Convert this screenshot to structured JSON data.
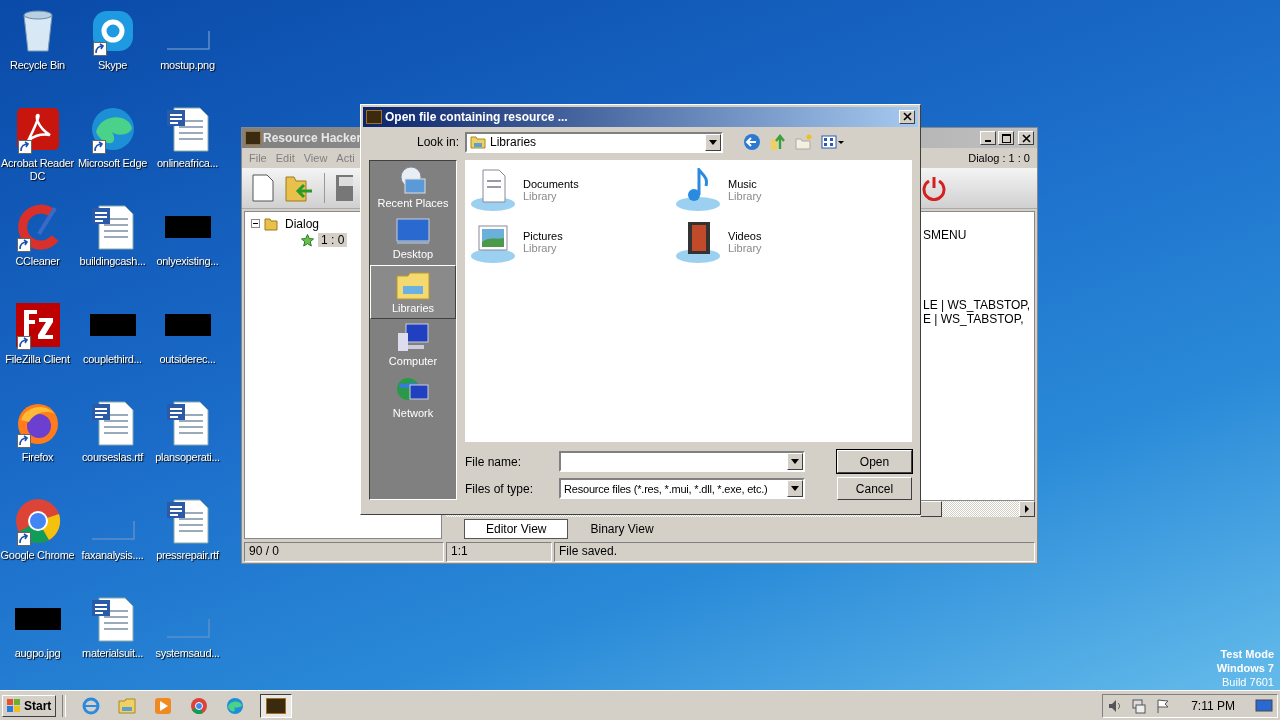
{
  "desktop": {
    "icons": [
      {
        "label": "Recycle Bin",
        "kind": "recycle",
        "shortcut": false
      },
      {
        "label": "Skype",
        "kind": "skype",
        "shortcut": true
      },
      {
        "label": "mostup.png",
        "kind": "blank",
        "shortcut": false
      },
      {
        "label": "Acrobat Reader DC",
        "kind": "acrobat",
        "shortcut": true
      },
      {
        "label": "Microsoft Edge",
        "kind": "edge",
        "shortcut": true
      },
      {
        "label": "onlineafrica...",
        "kind": "doc",
        "shortcut": false
      },
      {
        "label": "CCleaner",
        "kind": "ccleaner",
        "shortcut": true
      },
      {
        "label": "buildingcash...",
        "kind": "doc",
        "shortcut": false
      },
      {
        "label": "onlyexisting...",
        "kind": "black",
        "shortcut": false
      },
      {
        "label": "FileZilla Client",
        "kind": "filezilla",
        "shortcut": true
      },
      {
        "label": "couplethird...",
        "kind": "black",
        "shortcut": false
      },
      {
        "label": "outsiderec...",
        "kind": "black",
        "shortcut": false
      },
      {
        "label": "Firefox",
        "kind": "firefox",
        "shortcut": true
      },
      {
        "label": "courseslas.rtf",
        "kind": "doc",
        "shortcut": false
      },
      {
        "label": "plansoperati...",
        "kind": "doc",
        "shortcut": false
      },
      {
        "label": "Google Chrome",
        "kind": "chrome",
        "shortcut": true
      },
      {
        "label": "faxanalysis....",
        "kind": "blank",
        "shortcut": false
      },
      {
        "label": "pressrepair.rtf",
        "kind": "doc",
        "shortcut": false
      },
      {
        "label": "augpo.jpg",
        "kind": "black",
        "shortcut": false
      },
      {
        "label": "materialsuit...",
        "kind": "doc",
        "shortcut": false
      },
      {
        "label": "systemsaud...",
        "kind": "blank",
        "shortcut": false
      }
    ],
    "watermark_text": [
      "Test Mode",
      "Windows 7",
      "Build 7601"
    ]
  },
  "resource_hacker": {
    "title": "Resource Hacker",
    "menu": [
      "File",
      "Edit",
      "View",
      "Acti"
    ],
    "resource_label": "Dialog : 1 : 0",
    "tree": [
      {
        "label": "Dialog",
        "expanded": true,
        "children": [
          {
            "label": "1 : 0",
            "selected": true
          }
        ]
      }
    ],
    "code_lines": [
      "SMENU",
      "LE | WS_TABSTOP,",
      "E | WS_TABSTOP,"
    ],
    "tabs": [
      {
        "label": "Editor View",
        "selected": true
      },
      {
        "label": "Binary View",
        "selected": false
      }
    ],
    "status_bar": [
      "90 / 0",
      "1:1",
      "File saved."
    ]
  },
  "open_dialog": {
    "title": "Open file containing resource ...",
    "look_in_label": "Look in:",
    "look_in_value": "Libraries",
    "places": [
      {
        "label": "Recent Places",
        "kind": "recent",
        "selected": false
      },
      {
        "label": "Desktop",
        "kind": "desktop",
        "selected": false
      },
      {
        "label": "Libraries",
        "kind": "libraries",
        "selected": true
      },
      {
        "label": "Computer",
        "kind": "computer",
        "selected": false
      },
      {
        "label": "Network",
        "kind": "network",
        "selected": false
      }
    ],
    "items": [
      {
        "name": "Documents",
        "type": "Library",
        "kind": "documents"
      },
      {
        "name": "Music",
        "type": "Library",
        "kind": "music"
      },
      {
        "name": "Pictures",
        "type": "Library",
        "kind": "pictures"
      },
      {
        "name": "Videos",
        "type": "Library",
        "kind": "videos"
      }
    ],
    "file_name_label": "File name:",
    "files_of_type_label": "Files of type:",
    "files_of_type_value": "Resource files (*.res, *.mui, *.dll, *.exe, etc.)",
    "buttons": [
      "Open",
      "Cancel"
    ]
  },
  "taskbar": {
    "start": "Start",
    "apps": [
      {
        "kind": "ie",
        "active": false
      },
      {
        "kind": "explorer",
        "active": false
      },
      {
        "kind": "media",
        "active": false
      },
      {
        "kind": "chrome",
        "active": false
      },
      {
        "kind": "edge",
        "active": false
      },
      {
        "kind": "rh",
        "active": true
      }
    ],
    "time": "7:11 PM"
  }
}
